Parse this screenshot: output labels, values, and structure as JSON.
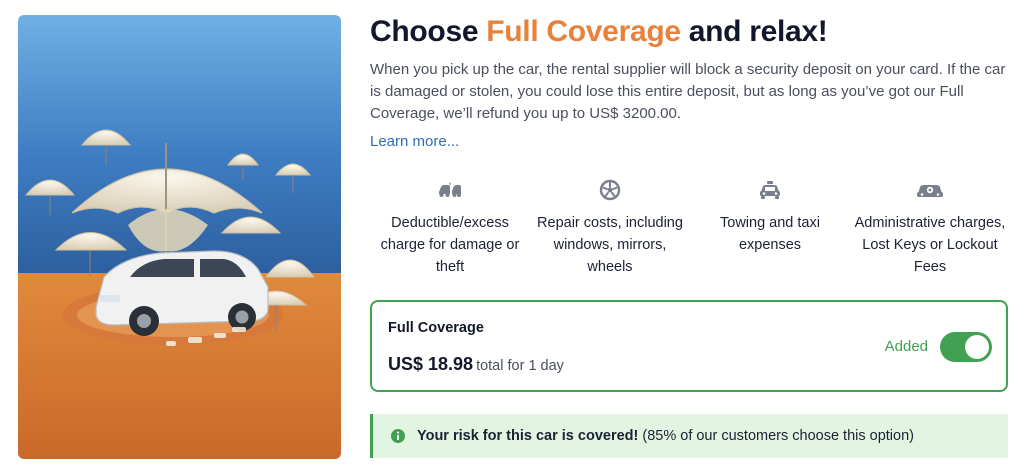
{
  "hero": {
    "image_desc_icon": "car-under-umbrellas-illustration"
  },
  "header": {
    "title_prefix": "Choose ",
    "title_accent": "Full Coverage",
    "title_suffix": " and relax!",
    "accent_color": "#e8823a"
  },
  "description": "When you pick up the car, the rental supplier will block a security deposit on your card. If the car is damaged or stolen, you could lose this entire deposit, but as long as you’ve got our Full Coverage, we’ll refund you up to US$ 3200.00.",
  "learn_more": "Learn more...",
  "features": [
    {
      "icon": "car-crash-icon",
      "label": "Deductible/excess charge for damage or theft"
    },
    {
      "icon": "wheel-icon",
      "label": "Repair costs, including windows, mirrors, wheels"
    },
    {
      "icon": "taxi-icon",
      "label": "Towing and taxi expenses"
    },
    {
      "icon": "car-key-icon",
      "label": "Administrative charges, Lost Keys or Lockout Fees"
    }
  ],
  "coverage_card": {
    "name": "Full Coverage",
    "price": "US$ 18.98",
    "price_unit": "total for 1 day",
    "status": "Added",
    "toggle_on": true,
    "color": "#41a152"
  },
  "banner": {
    "icon": "info-icon",
    "bold_text": "Your risk for this car is covered!",
    "text": " (85% of our customers choose this option)"
  }
}
